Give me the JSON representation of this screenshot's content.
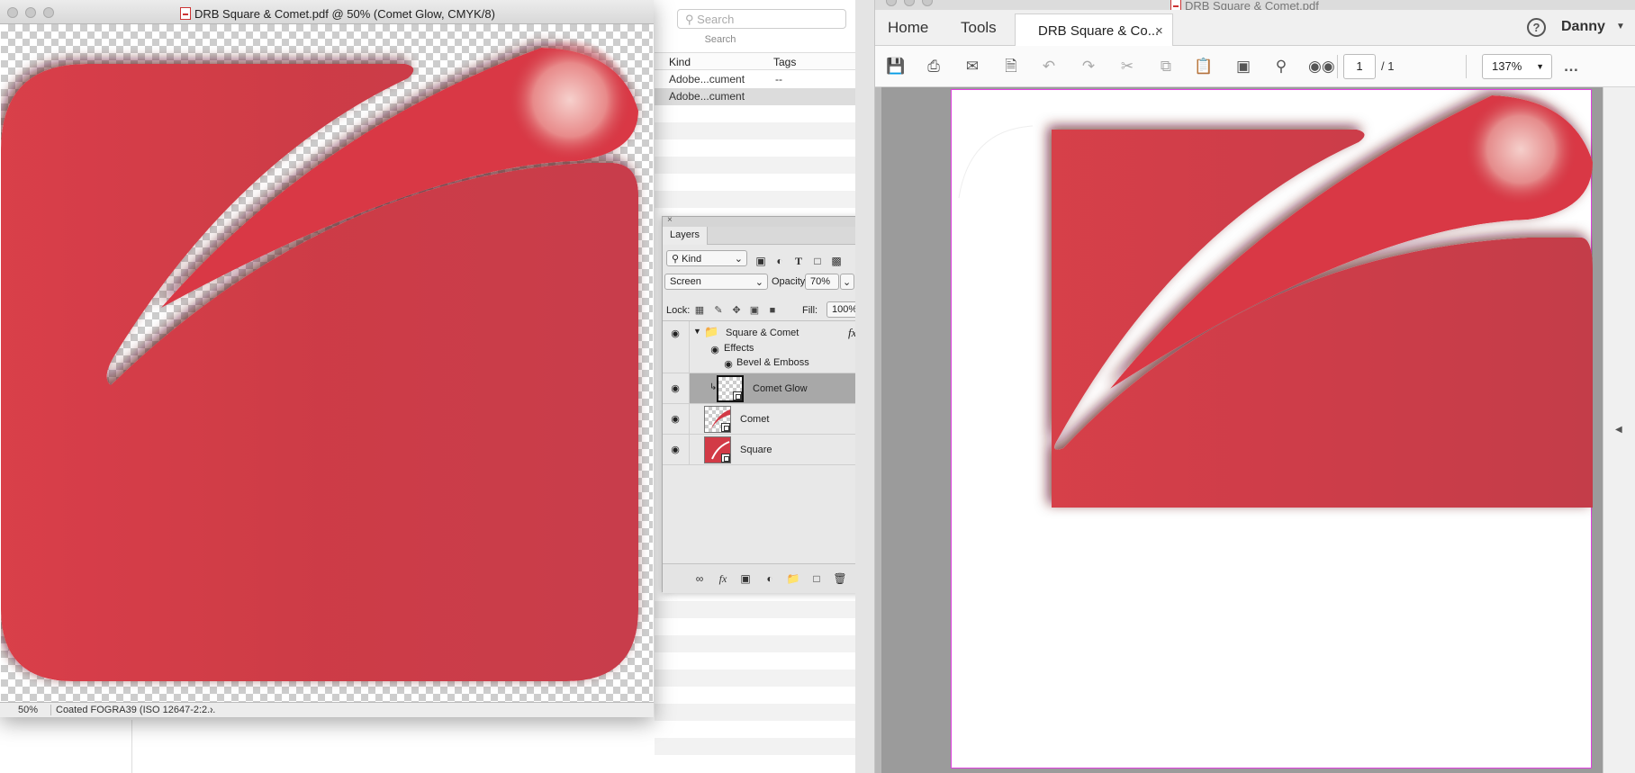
{
  "finder": {
    "search_placeholder": "Search",
    "search_caption": "Search",
    "columns": [
      "Kind",
      "Tags"
    ],
    "rows": [
      {
        "kind": "Adobe...cument",
        "tags": "--"
      },
      {
        "kind": "Adobe...cument",
        "tags": ""
      }
    ]
  },
  "photoshop": {
    "title": "DRB Square & Comet.pdf @ 50% (Comet Glow, CMYK/8)",
    "zoom": "50%",
    "color_profile": "Coated FOGRA39 (ISO 12647-2:2...",
    "status_arrow": "›"
  },
  "layers_panel": {
    "tab": "Layers",
    "filter_kind": "Kind",
    "blend_mode": "Screen",
    "opacity_label": "Opacity:",
    "opacity": "70%",
    "lock_label": "Lock:",
    "fill_label": "Fill:",
    "fill": "100%",
    "group_name": "Square & Comet",
    "fx_badge": "fx",
    "effects_label": "Effects",
    "bevel_label": "Bevel & Emboss",
    "layers": [
      "Comet Glow",
      "Comet",
      "Square"
    ]
  },
  "acrobat": {
    "window_title": "DRB Square & Comet.pdf",
    "home_tab": "Home",
    "tools_tab": "Tools",
    "doc_tab": "DRB Square & Co...",
    "close_glyph": "×",
    "help_glyph": "?",
    "user": "Danny",
    "page_current": "1",
    "page_total": "/ 1",
    "zoom": "137%"
  },
  "colors": {
    "logo_red": "#d23a46",
    "logo_dark": "#8e1f2a",
    "highlight": "#f3c6c6"
  }
}
